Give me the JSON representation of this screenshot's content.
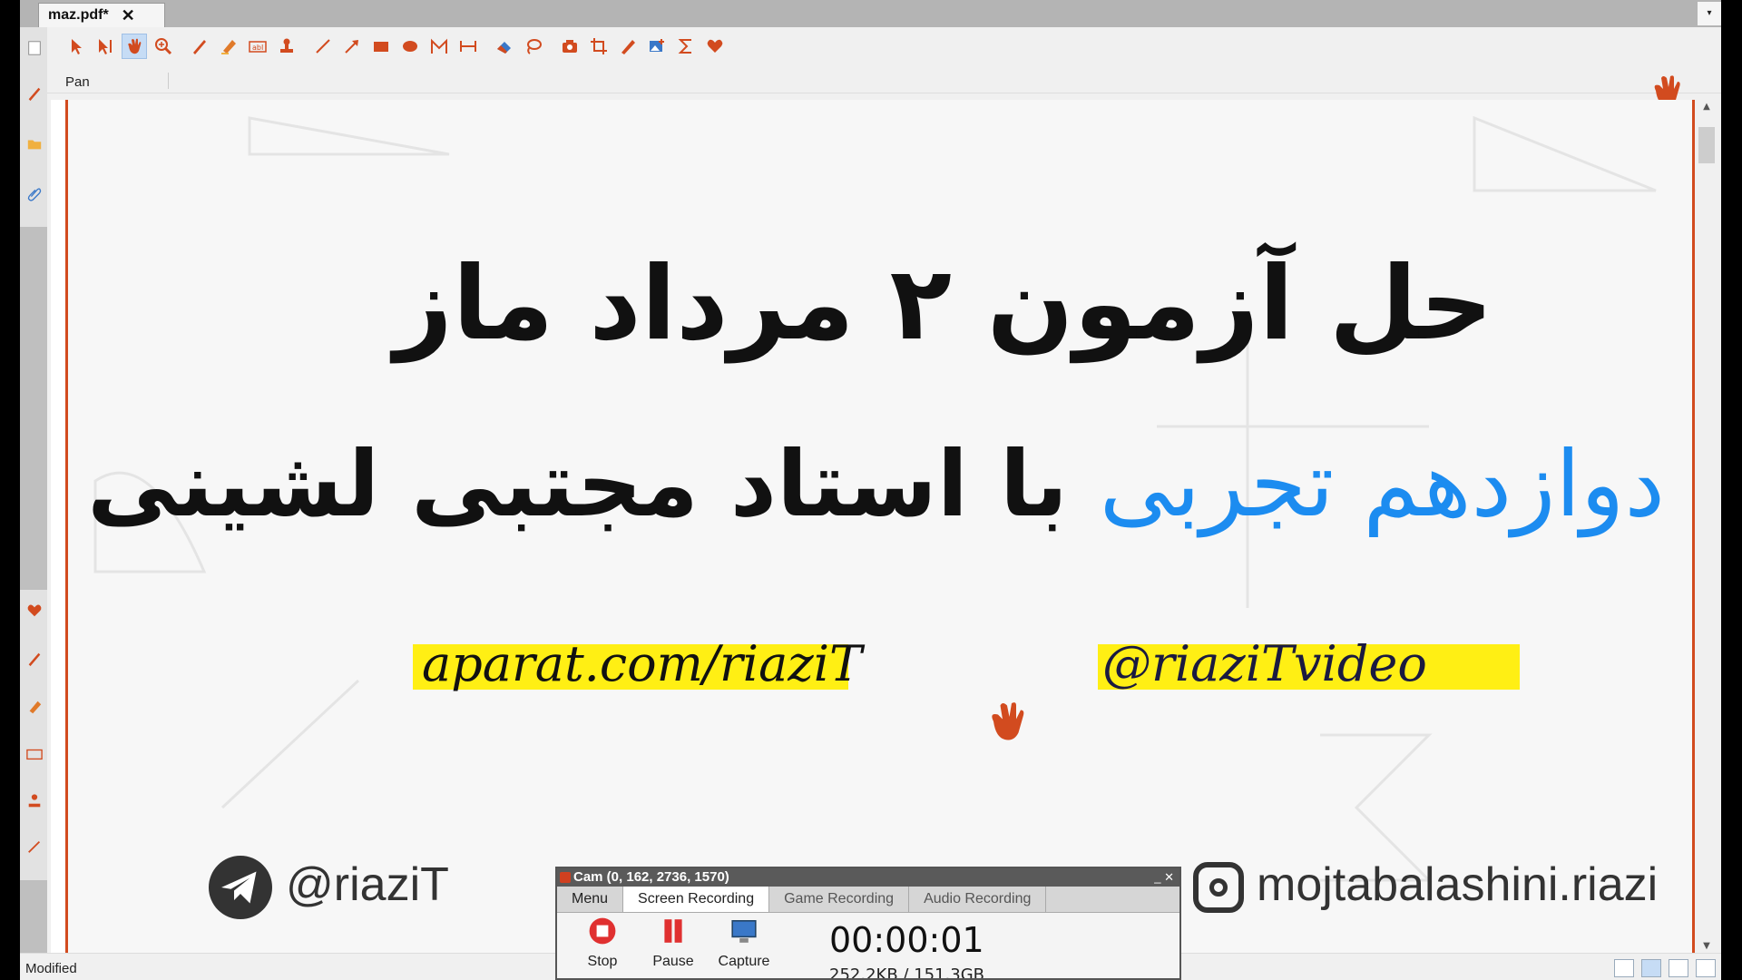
{
  "tab": {
    "filename": "maz.pdf*",
    "close": "✕",
    "menu": "▾"
  },
  "toolbar": {
    "mode_label": "Pan",
    "tools": [
      "select-arrow",
      "select-text",
      "pan-hand",
      "zoom",
      "pencil",
      "highlighter",
      "textbox",
      "stamp",
      "line",
      "arrow",
      "rectangle",
      "ellipse",
      "polygon",
      "measure",
      "eraser",
      "lasso",
      "snapshot",
      "crop",
      "ruler-pen",
      "insert-image",
      "sigma",
      "favorites"
    ]
  },
  "sidebar": {
    "icons": [
      "page-icon",
      "pen-icon",
      "folder-icon",
      "paperclip-icon",
      "heart-icon",
      "pencil-icon",
      "highlighter-icon",
      "textbox-icon",
      "stamp-icon",
      "arrow-icon"
    ]
  },
  "document": {
    "title_line1": "حل آزمون ۲ مرداد ماز",
    "title_line2_blue": "دوازدهم تجربی",
    "title_line2_dark": "با استاد مجتبی لشینی",
    "link_aparat": "aparat.com/riaziT",
    "link_handle": "@riaziTvideo",
    "telegram": "@riaziT",
    "instagram": "mojtabalashini.riazi",
    "colors": {
      "accent": "#d24b1f",
      "title_blue": "#1c8cf0",
      "highlight": "#ffef14"
    }
  },
  "status": {
    "text": "Modified"
  },
  "recorder": {
    "title": "Cam (0, 162, 2736, 1570)",
    "tabs": [
      "Menu",
      "Screen Recording",
      "Game Recording",
      "Audio Recording"
    ],
    "selected_tab": "Screen Recording",
    "buttons": {
      "stop": "Stop",
      "pause": "Pause",
      "capture": "Capture"
    },
    "timer": "00:00:01",
    "size": "252.2KB / 151.3GB"
  }
}
